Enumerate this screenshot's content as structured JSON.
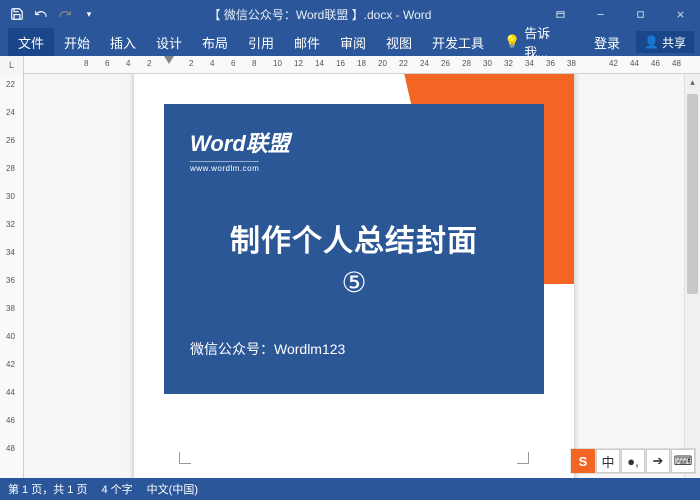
{
  "titlebar": {
    "title": "【 微信公众号：Word联盟 】.docx - Word"
  },
  "ribbon": {
    "file": "文件",
    "tabs": [
      "开始",
      "插入",
      "设计",
      "布局",
      "引用",
      "邮件",
      "审阅",
      "视图",
      "开发工具"
    ],
    "tell_me": "告诉我...",
    "login": "登录",
    "share": "共享"
  },
  "ruler": {
    "corner": "L",
    "h_ticks": [
      "8",
      "6",
      "4",
      "2",
      "",
      "2",
      "4",
      "6",
      "8",
      "10",
      "12",
      "14",
      "16",
      "18",
      "20",
      "22",
      "24",
      "26",
      "28",
      "30",
      "32",
      "34",
      "36",
      "38",
      "",
      "42",
      "44",
      "46",
      "48"
    ],
    "v_ticks": [
      "22",
      "24",
      "26",
      "28",
      "30",
      "32",
      "34",
      "36",
      "38",
      "40",
      "42",
      "44",
      "46",
      "48"
    ]
  },
  "document": {
    "logo_main": "Word",
    "logo_cn": "联盟",
    "logo_url": "www.wordlm.com",
    "main_title": "制作个人总结封面",
    "circ_num": "⑤",
    "sub_text": "微信公众号：Wordlm123"
  },
  "status": {
    "page": "第 1 页，共 1 页",
    "words": "4 个字",
    "lang": "中文(中国)"
  },
  "ime": {
    "items": [
      "S",
      "中",
      "●,",
      "➔",
      "⌨"
    ],
    "orange_idx": 0
  }
}
